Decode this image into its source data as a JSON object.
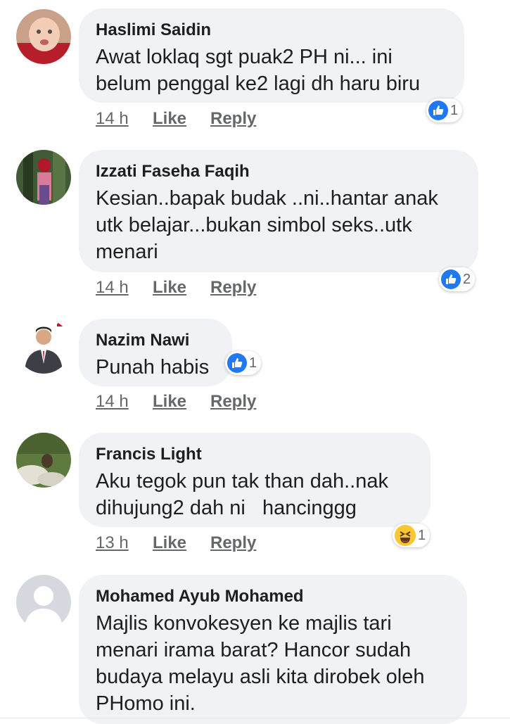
{
  "comments": [
    {
      "author": "Haslimi Saidin",
      "text": "Awat loklaq sgt puak2 PH ni... ini\nbelum penggal ke2 lagi dh haru biru",
      "time": "14 h",
      "like": "Like",
      "reply": "Reply",
      "reaction": "like",
      "reaction_count": "1"
    },
    {
      "author": "Izzati Faseha Faqih",
      "text": "Kesian..bapak budak ..ni..hantar anak\nutk belajar...bukan simbol seks..utk\nmenari",
      "time": "14 h",
      "like": "Like",
      "reply": "Reply",
      "reaction": "like",
      "reaction_count": "2"
    },
    {
      "author": "Nazim Nawi",
      "text": "Punah habis",
      "time": "14 h",
      "like": "Like",
      "reply": "Reply",
      "reaction": "like",
      "reaction_count": "1"
    },
    {
      "author": "Francis Light",
      "text": "Aku tegok pun tak than dah..nak\ndihujung2 dah ni   hancinggg",
      "time": "13 h",
      "like": "Like",
      "reply": "Reply",
      "reaction": "haha",
      "reaction_count": "1"
    },
    {
      "author": "Mohamed Ayub Mohamed",
      "text": "Majlis konvokesyen ke majlis tari\nmenari irama barat? Hancor sudah\nbudaya melayu asli kita dirobek oleh\nPHomo ini."
    }
  ],
  "colors": {
    "bubble": "#f0f2f5",
    "like_blue": "#2078f4",
    "muted": "#65676b"
  }
}
